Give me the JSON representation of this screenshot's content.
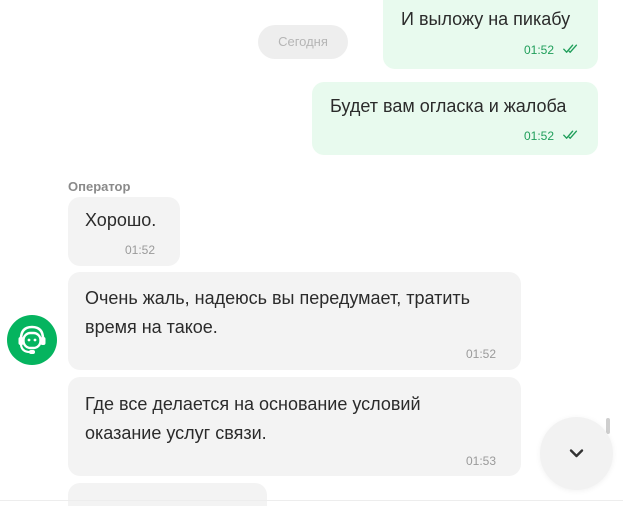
{
  "date_separator": "Сегодня",
  "operator_label": "Оператор",
  "messages": [
    {
      "direction": "out",
      "text": "И выложу на пикабу",
      "time": "01:52",
      "status": "read"
    },
    {
      "direction": "out",
      "text": "Будет вам огласка и жалоба",
      "time": "01:52",
      "status": "read"
    },
    {
      "direction": "in",
      "text": "Хорошо.",
      "time": "01:52"
    },
    {
      "direction": "in",
      "text": "Очень жаль, надеюсь вы передумает, тратить время на такое.",
      "time": "01:52"
    },
    {
      "direction": "in",
      "text": "Где все делается на основание условий оказание услуг связи.",
      "time": "01:53"
    }
  ],
  "icons": {
    "read_status": "double-check-icon",
    "avatar": "operator-headset-icon",
    "scroll_down": "chevron-down-icon"
  },
  "colors": {
    "outgoing_bubble": "#e8faee",
    "incoming_bubble": "#f3f3f3",
    "outgoing_time": "#1f9e5a",
    "avatar_bg": "#05b45f"
  }
}
